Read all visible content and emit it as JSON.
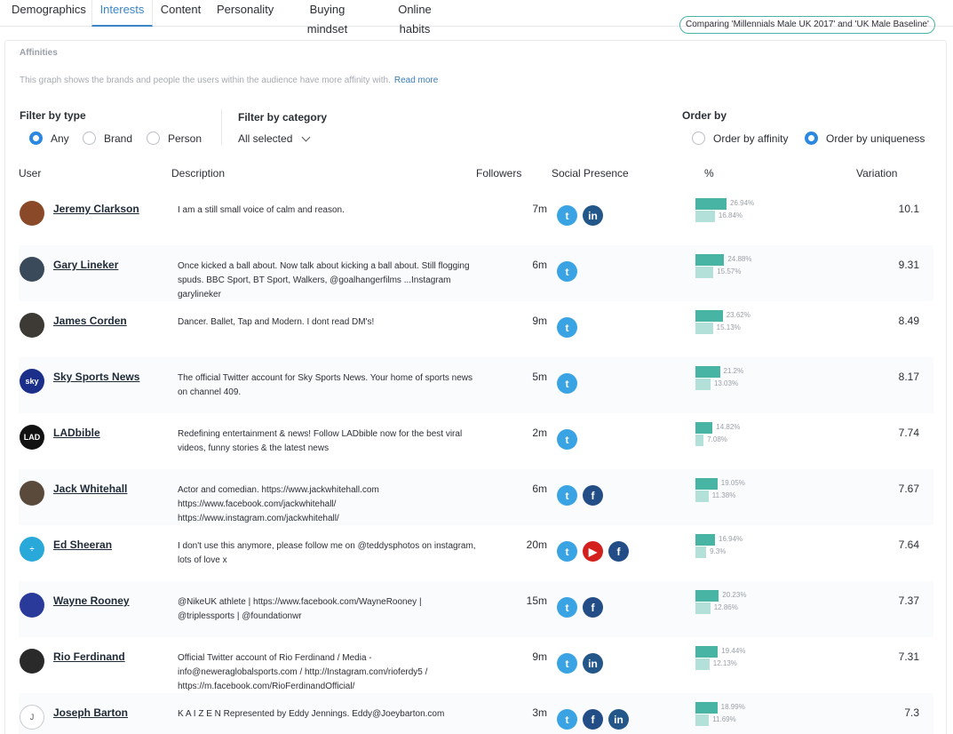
{
  "tabs": [
    "Demographics",
    "Interests",
    "Content",
    "Personality",
    "Buying mindset",
    "Online habits"
  ],
  "active_tab": "Interests",
  "comparison": "Comparing 'Millennials Male UK 2017' and 'UK Male Baseline'",
  "panel": {
    "title": "Affinities",
    "description": "This graph shows the brands and people the users within the audience have more affinity with.",
    "read_more": "Read more"
  },
  "filters": {
    "type_label": "Filter by type",
    "type_options": [
      "Any",
      "Brand",
      "Person"
    ],
    "type_selected": "Any",
    "category_label": "Filter by category",
    "category_value": "All selected",
    "order_label": "Order by",
    "order_options": [
      "Order by affinity",
      "Order by uniqueness"
    ],
    "order_selected": "Order by uniqueness"
  },
  "columns": {
    "user": "User",
    "description": "Description",
    "followers": "Followers",
    "social": "Social Presence",
    "pct": "%",
    "variation": "Variation"
  },
  "colors": {
    "accent": "#3a86c8",
    "audience_bar": "#48b4a4",
    "baseline_bar": "#b3e0d8",
    "twitter": "#3aa3e3",
    "linkedin": "#235789",
    "facebook": "#224d86",
    "youtube": "#d3201d"
  },
  "rows": [
    {
      "name": "Jeremy Clarkson",
      "avatar_initial": "",
      "avatar_color": "#8a4a2a",
      "description": "I am a still small voice of calm and reason.",
      "followers": "7m",
      "social": [
        "twitter",
        "linkedin"
      ],
      "audience_pct": 26.94,
      "baseline_pct": 16.84,
      "audience_label": "26.94%",
      "baseline_label": "16.84%",
      "variation": "10.1"
    },
    {
      "name": "Gary Lineker",
      "avatar_initial": "",
      "avatar_color": "#3b4a5a",
      "description": "Once kicked a ball about. Now talk about kicking a ball about. Still flogging spuds. BBC Sport, BT Sport, Walkers, @goalhangerfilms ...Instagram garylineker",
      "followers": "6m",
      "social": [
        "twitter"
      ],
      "audience_pct": 24.88,
      "baseline_pct": 15.57,
      "audience_label": "24.88%",
      "baseline_label": "15.57%",
      "variation": "9.31"
    },
    {
      "name": "James Corden",
      "avatar_initial": "",
      "avatar_color": "#3d3a36",
      "description": "Dancer. Ballet, Tap and Modern. I dont read DM's!",
      "followers": "9m",
      "social": [
        "twitter"
      ],
      "audience_pct": 23.62,
      "baseline_pct": 15.13,
      "audience_label": "23.62%",
      "baseline_label": "15.13%",
      "variation": "8.49"
    },
    {
      "name": "Sky Sports News",
      "avatar_initial": "sky",
      "avatar_color": "#1b2f8a",
      "description": "The official Twitter account for Sky Sports News. Your home of sports news on channel 409.",
      "followers": "5m",
      "social": [
        "twitter"
      ],
      "audience_pct": 21.2,
      "baseline_pct": 13.03,
      "audience_label": "21.2%",
      "baseline_label": "13.03%",
      "variation": "8.17"
    },
    {
      "name": "LADbible",
      "avatar_initial": "LAD",
      "avatar_color": "#111111",
      "description": "Redefining entertainment & news! Follow LADbible now for the best viral videos, funny stories & the latest news",
      "followers": "2m",
      "social": [
        "twitter"
      ],
      "audience_pct": 14.82,
      "baseline_pct": 7.08,
      "audience_label": "14.82%",
      "baseline_label": "7.08%",
      "variation": "7.74"
    },
    {
      "name": "Jack Whitehall",
      "avatar_initial": "",
      "avatar_color": "#5a4a3c",
      "description": "Actor and comedian. https://www.jackwhitehall.com https://www.facebook.com/jackwhitehall/ https://www.instagram.com/jackwhitehall/",
      "followers": "6m",
      "social": [
        "twitter",
        "facebook"
      ],
      "audience_pct": 19.05,
      "baseline_pct": 11.38,
      "audience_label": "19.05%",
      "baseline_label": "11.38%",
      "variation": "7.67"
    },
    {
      "name": "Ed Sheeran",
      "avatar_initial": "÷",
      "avatar_color": "#29a9d9",
      "description": "I don't use this anymore, please follow me on @teddysphotos on instagram, lots of love x",
      "followers": "20m",
      "social": [
        "twitter",
        "youtube",
        "facebook"
      ],
      "audience_pct": 16.94,
      "baseline_pct": 9.3,
      "audience_label": "16.94%",
      "baseline_label": "9.3%",
      "variation": "7.64"
    },
    {
      "name": "Wayne Rooney",
      "avatar_initial": "",
      "avatar_color": "#2a3a9a",
      "description": "@NikeUK athlete | https://www.facebook.com/WayneRooney | @triplessports | @foundationwr",
      "followers": "15m",
      "social": [
        "twitter",
        "facebook"
      ],
      "audience_pct": 20.23,
      "baseline_pct": 12.86,
      "audience_label": "20.23%",
      "baseline_label": "12.86%",
      "variation": "7.37"
    },
    {
      "name": "Rio Ferdinand",
      "avatar_initial": "",
      "avatar_color": "#2a2a2a",
      "description": "Official Twitter account of Rio Ferdinand / Media - info@neweraglobalsports.com / http://Instagram.com/rioferdy5 / https://m.facebook.com/RioFerdinandOfficial/",
      "followers": "9m",
      "social": [
        "twitter",
        "linkedin"
      ],
      "audience_pct": 19.44,
      "baseline_pct": 12.13,
      "audience_label": "19.44%",
      "baseline_label": "12.13%",
      "variation": "7.31"
    },
    {
      "name": "Joseph Barton",
      "avatar_initial": "J",
      "avatar_color": "#ffffff",
      "description": "K A I Z E N Represented by Eddy Jennings. Eddy@Joeybarton.com",
      "followers": "3m",
      "social": [
        "twitter",
        "facebook",
        "linkedin"
      ],
      "audience_pct": 18.99,
      "baseline_pct": 11.69,
      "audience_label": "18.99%",
      "baseline_label": "11.69%",
      "variation": "7.3"
    }
  ]
}
